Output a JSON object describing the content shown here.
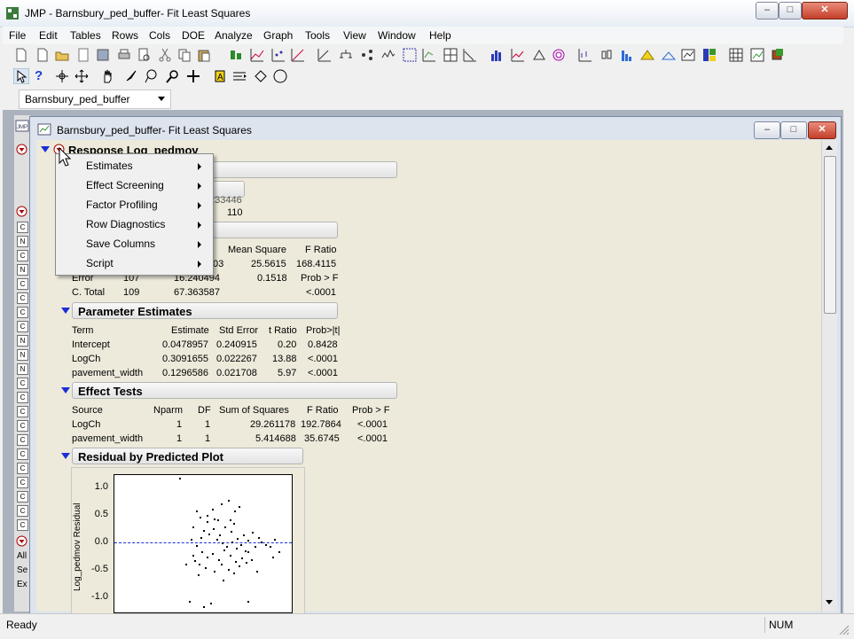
{
  "app": {
    "window_title": "JMP - Barnsbury_ped_buffer- Fit Least Squares"
  },
  "menu": [
    "File",
    "Edit",
    "Tables",
    "Rows",
    "Cols",
    "DOE",
    "Analyze",
    "Graph",
    "Tools",
    "View",
    "Window",
    "Help"
  ],
  "table_selector": {
    "value": "Barnsbury_ped_buffer"
  },
  "child_window": {
    "title": "Barnsbury_ped_buffer- Fit Least Squares"
  },
  "report": {
    "response_title": "Response Log_pedmov",
    "summary_partial": {
      "value1": "233446",
      "value2": "110"
    },
    "anova": {
      "headers": [
        "es",
        "Mean Square",
        "F Ratio"
      ],
      "rows": [
        {
          "source": "",
          "df": "",
          "ss": "03",
          "ms": "25.5615",
          "f": "168.4115"
        },
        {
          "source": "Error",
          "df": "107",
          "ss": "16.240494",
          "ms": "0.1518",
          "f": "Prob > F"
        },
        {
          "source": "C. Total",
          "df": "109",
          "ss": "67.363587",
          "ms": "",
          "f": "<.0001"
        }
      ]
    },
    "parameter_estimates": {
      "title": "Parameter Estimates",
      "headers": [
        "Term",
        "Estimate",
        "Std Error",
        "t Ratio",
        "Prob>|t|"
      ],
      "rows": [
        [
          "Intercept",
          "0.0478957",
          "0.240915",
          "0.20",
          "0.8428"
        ],
        [
          "LogCh",
          "0.3091655",
          "0.022267",
          "13.88",
          "<.0001"
        ],
        [
          "pavement_width",
          "0.1296586",
          "0.021708",
          "5.97",
          "<.0001"
        ]
      ]
    },
    "effect_tests": {
      "title": "Effect Tests",
      "headers": [
        "Source",
        "Nparm",
        "DF",
        "Sum of Squares",
        "F Ratio",
        "Prob > F"
      ],
      "rows": [
        [
          "LogCh",
          "1",
          "1",
          "29.261178",
          "192.7864",
          "<.0001"
        ],
        [
          "pavement_width",
          "1",
          "1",
          "5.414688",
          "35.6745",
          "<.0001"
        ]
      ]
    },
    "residual_plot": {
      "title": "Residual by Predicted Plot",
      "ylabel": "Log_pedmov Residual",
      "yticks": [
        "1.0",
        "0.5",
        "0.0",
        "-0.5",
        "-1.0"
      ]
    }
  },
  "popup_menu": [
    "Estimates",
    "Effect Screening",
    "Factor Profiling",
    "Row Diagnostics",
    "Save Columns",
    "Script"
  ],
  "left_panel_labels": [
    "All",
    "Se",
    "Ex"
  ],
  "status": {
    "left": "Ready",
    "right": "NUM"
  },
  "colors": {
    "disclosure_triangle": "#1a2fd8",
    "report_bg": "#edeadb"
  }
}
